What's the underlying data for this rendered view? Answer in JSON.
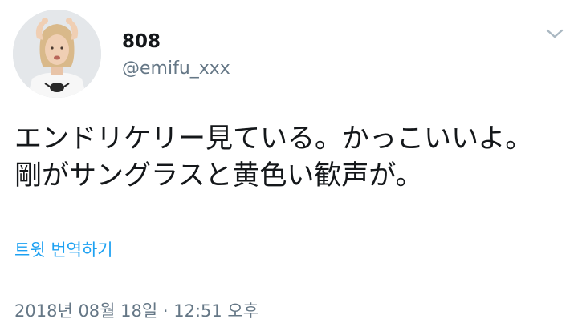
{
  "tweet": {
    "display_name": "808",
    "handle": "@emifu_xxx",
    "text": "エンドリケリー見ている。かっこいいよ。\n剛がサングラスと黄色い歓声が。",
    "translate_label": "트윗 번역하기",
    "timestamp": "2018년 08월 18일 · 12:51 오후"
  },
  "icons": {
    "menu": "chevron-down-icon"
  },
  "colors": {
    "link": "#1da1f2",
    "secondary_text": "#657786",
    "primary_text": "#14171a"
  }
}
